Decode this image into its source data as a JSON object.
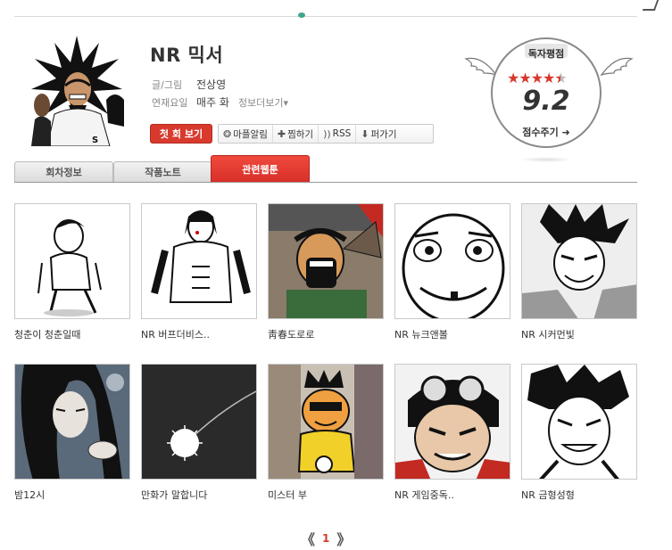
{
  "series": {
    "title": "NR 믹서",
    "author_label": "글/그림",
    "author": "전상영",
    "schedule_label": "연재요일",
    "schedule": "매주 화",
    "info_more": "정보더보기▾"
  },
  "actions": {
    "first_episode": "첫 회 보기",
    "toolbar": [
      {
        "label": "마플알림",
        "icon": "bell-icon",
        "glyph": "❂"
      },
      {
        "label": "찜하기",
        "icon": "plus-icon",
        "glyph": "✚"
      },
      {
        "label": "RSS",
        "icon": "rss-icon",
        "glyph": "))"
      },
      {
        "label": "퍼가기",
        "icon": "download-icon",
        "glyph": "⬇"
      }
    ]
  },
  "rating": {
    "title": "독자평점",
    "score": "9.2",
    "stars_filled": 4.5,
    "rate_button": "점수주기 ➜",
    "star_color": "#d8392c"
  },
  "tabs": [
    {
      "label": "회차정보",
      "active": false
    },
    {
      "label": "작품노트",
      "active": false
    },
    {
      "label": "관련웹툰",
      "active": true
    }
  ],
  "related": [
    {
      "title": "청춘이 청춘일때"
    },
    {
      "title": "NR 버프더비스.."
    },
    {
      "title": "靑春도로로"
    },
    {
      "title": "NR 뉴크앤볼"
    },
    {
      "title": "NR 시커먼빛"
    },
    {
      "title": "밤12시"
    },
    {
      "title": "만화가 말합니다"
    },
    {
      "title": "미스터 부"
    },
    {
      "title": "NR 게임중독.."
    },
    {
      "title": "NR 금형성형"
    }
  ],
  "pagination": {
    "current": "1"
  },
  "colors": {
    "accent": "#d8392c",
    "tab_active": "#e3362c"
  }
}
